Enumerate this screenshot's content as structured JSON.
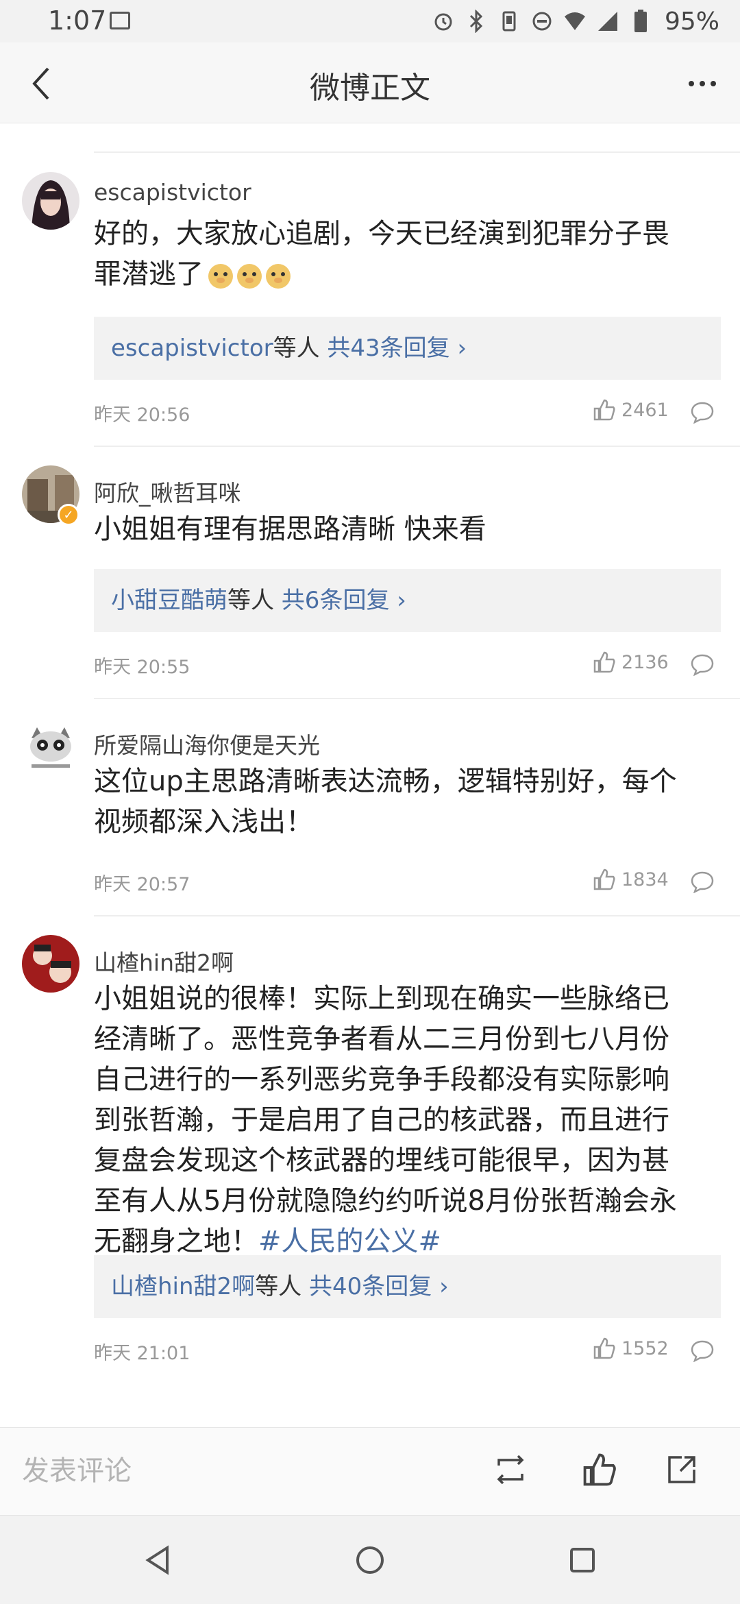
{
  "status_bar": {
    "time": "1:07",
    "battery": "95%",
    "icons": [
      "image-icon",
      "alarm-icon",
      "bluetooth-icon",
      "vibrate-icon",
      "dnd-icon",
      "wifi-icon",
      "signal-icon",
      "battery-icon"
    ]
  },
  "header": {
    "title": "微博正文",
    "back_icon": "back-chevron-icon",
    "more_icon": "more-dots-icon"
  },
  "comments": [
    {
      "username": "escapistvictor",
      "text_line1": "好的，大家放心追剧，今天已经演到犯罪分子畏",
      "text_line2": "罪潜逃了",
      "emoji": [
        "doge",
        "doge",
        "doge"
      ],
      "reply_user": "escapistvictor",
      "reply_mid": "等人 ",
      "reply_count": "共43条回复 ›",
      "time": "昨天 20:56",
      "likes": "2461",
      "verified": false
    },
    {
      "username": "阿欣_啾哲耳咪",
      "text_line1": "小姐姐有理有据思路清晰 快来看",
      "reply_user": "小甜豆酷萌",
      "reply_mid": "等人 ",
      "reply_count": "共6条回复 ›",
      "time": "昨天 20:55",
      "likes": "2136",
      "verified": true
    },
    {
      "username": "所爱隔山海你便是天光",
      "text_line1": "这位up主思路清晰表达流畅，逻辑特别好，每个",
      "text_line2": "视频都深入浅出！",
      "time": "昨天 20:57",
      "likes": "1834",
      "verified": false
    },
    {
      "username": "山楂hin甜2啊",
      "lines": [
        "小姐姐说的很棒！实际上到现在确实一些脉络已",
        "经清晰了。恶性竞争者看从二三月份到七八月份",
        "自己进行的一系列恶劣竞争手段都没有实际影响",
        "到张哲瀚，于是启用了自己的核武器，而且进行",
        "复盘会发现这个核武器的埋线可能很早，因为甚",
        "至有人从5月份就隐隐约约听说8月份张哲瀚会永"
      ],
      "last_line": "无翻身之地！",
      "hashtag": "#人民的公义#",
      "reply_user": "山楂hin甜2啊",
      "reply_mid": "等人 ",
      "reply_count": "共40条回复 ›",
      "time": "昨天 21:01",
      "likes": "1552",
      "verified": false
    }
  ],
  "bottom_bar": {
    "comment_placeholder": "发表评论",
    "icons": [
      "repost-icon",
      "like-icon",
      "share-icon"
    ]
  },
  "nav_bar": {
    "icons": [
      "nav-back-icon",
      "nav-home-icon",
      "nav-recents-icon"
    ]
  }
}
